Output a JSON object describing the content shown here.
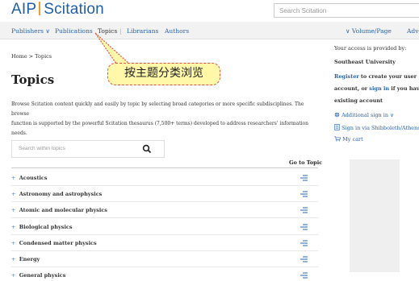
{
  "header": {
    "logo_aip": "AIP",
    "logo_scitation": "Scitation",
    "search_placeholder": "Search Scitation"
  },
  "nav": {
    "publishers": "Publishers ∨",
    "publications": "Publications",
    "topics": "Topics",
    "separator": "|",
    "librarians": "Librarians",
    "authors": "Authors",
    "volume_page": "∨ Volume/Page",
    "advanced": "Adva"
  },
  "breadcrumb": "Home > Topics",
  "page_title": "Topics",
  "description_line1": "Browse Scitation content quickly and easily by topic by selecting broad categories or more specific subdisciplines. The browse",
  "description_line2": "function is supported by the powerful Scitation thesaurus (7,500+ terms) developed to address researchers' information needs.",
  "callout_text": "按主题分类浏览",
  "topic_search_placeholder": "Search within topics",
  "goto_topic": "Go to Topic",
  "topics": [
    "Acoustics",
    "Astronomy and astrophysics",
    "Atomic and molecular physics",
    "Biological physics",
    "Condensed matter physics",
    "Energy",
    "General physics"
  ],
  "sidebar": {
    "access_label": "Your access is provided by:",
    "institution": "Southeast University",
    "register_link": "Register",
    "register_rest": "to create your user",
    "account_prefix": "account, or",
    "sign_in_link": "sign in",
    "account_rest": "if you have an",
    "existing": "existing account",
    "additional_sign_in": "Additional sign in ∨",
    "shibboleth": "Sign in via Shibboleth/Athens",
    "cart": "My cart"
  },
  "colors": {
    "brand_blue": "#1f5fa8",
    "logo_accent": "#f0a020",
    "callout_bg": "#fff8a8",
    "callout_border": "#e05050"
  }
}
